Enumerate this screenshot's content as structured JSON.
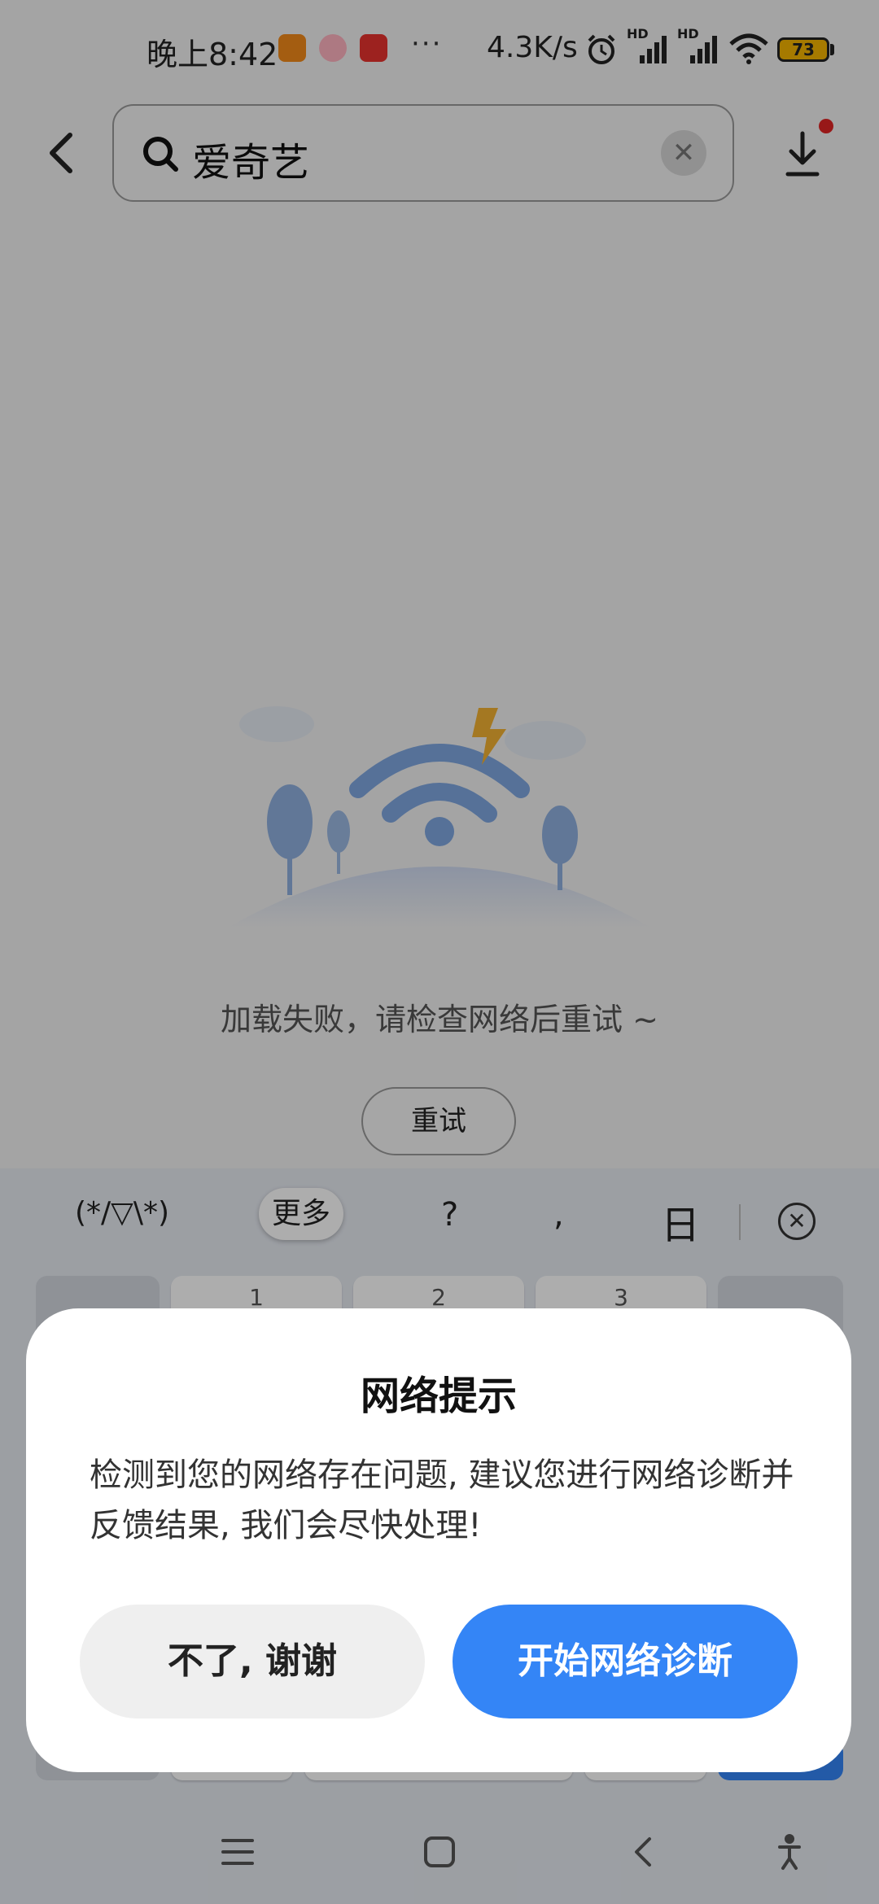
{
  "status_bar": {
    "time": "晚上8:42",
    "more": "···",
    "net_speed": "4.3K/s",
    "signal_tags": [
      "HD",
      "HD"
    ],
    "battery": "73"
  },
  "top_bar": {
    "search_query": "爱奇艺",
    "clear_symbol": "✕"
  },
  "content": {
    "error_message": "加载失败，请检查网络后重试 ~",
    "retry_label": "重试"
  },
  "keyboard": {
    "emoticon": "(*/▽\\*)",
    "more_label": "更多",
    "question": "?",
    "comma": ",",
    "sun_char": "日",
    "close_symbol": "✕",
    "number_keys": [
      "1",
      "2",
      "3"
    ]
  },
  "dialog": {
    "title": "网络提示",
    "body": "检测到您的网络存在问题, 建议您进行网络诊断并反馈结果, 我们会尽快处理!",
    "cancel_label": "不了, 谢谢",
    "confirm_label": "开始网络诊断"
  },
  "colors": {
    "primary": "#3485f6",
    "notification_dot": "#e02424",
    "battery": "#f5b400"
  }
}
